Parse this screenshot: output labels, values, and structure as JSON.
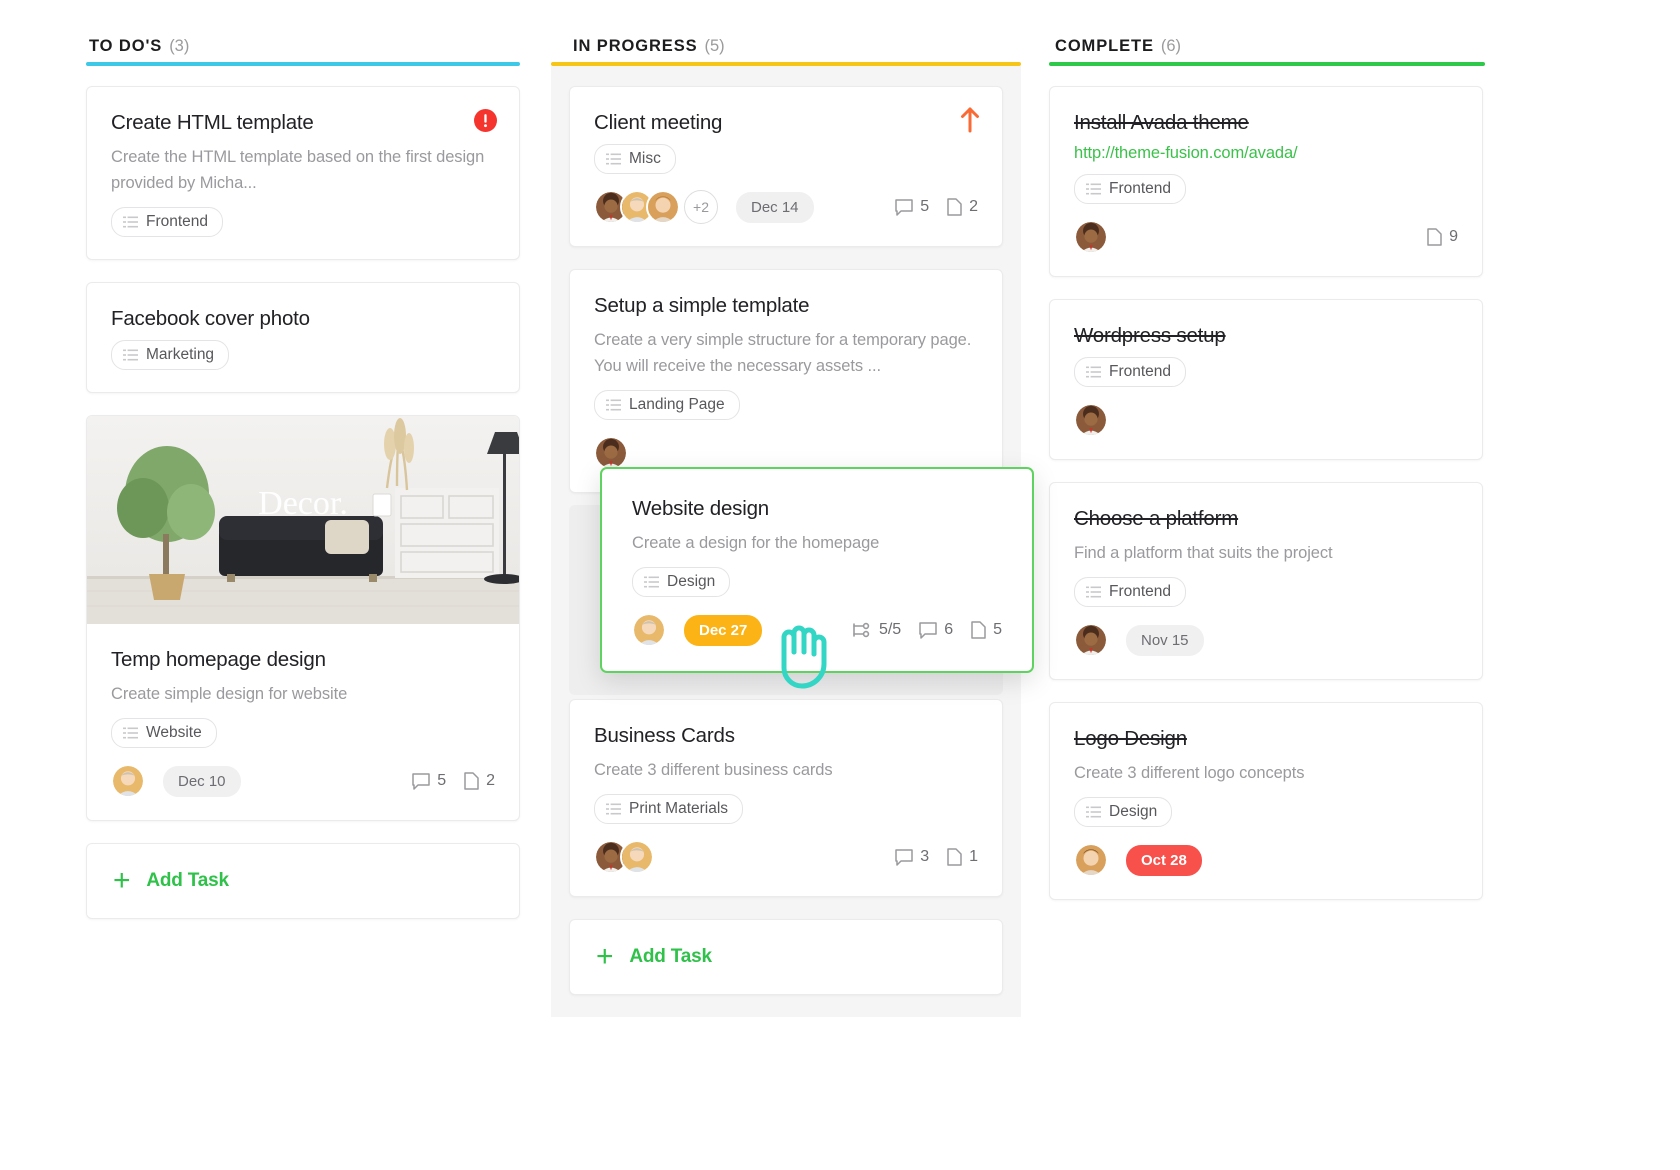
{
  "colors": {
    "todo_rule": "#3ec8e8",
    "progress_rule": "#f5c518",
    "complete_rule": "#2ec84a",
    "accent_green": "#2fc14a",
    "link_green": "#3bc14a",
    "amber_badge": "#fcb316",
    "red_badge": "#f8504b",
    "alert_red": "#f5342e",
    "arrow_orange": "#f96a34",
    "drag_border": "#5fd35f",
    "cursor_teal": "#33d6c4"
  },
  "columns": [
    {
      "id": "todo",
      "title": "TO DO'S",
      "count": "(3)",
      "add_task_label": "Add Task",
      "cards": [
        {
          "title": "Create HTML template",
          "desc": "Create the HTML template based on the first design provided by Micha...",
          "tag": "Frontend",
          "alert": true
        },
        {
          "title": "Facebook cover photo",
          "tag": "Marketing"
        },
        {
          "photo_caption": "Decor.",
          "title": "Temp homepage design",
          "desc": "Create simple design for website",
          "tag": "Website",
          "date": "Dec 10",
          "comments": "5",
          "files": "2"
        }
      ]
    },
    {
      "id": "progress",
      "title": "IN PROGRESS",
      "count": "(5)",
      "add_task_label": "Add Task",
      "cards": [
        {
          "title": "Client meeting",
          "tag": "Misc",
          "avatars_extra": "+2",
          "date": "Dec 14",
          "comments": "5",
          "files": "2",
          "priority_up": true
        },
        {
          "title": "Setup a simple template",
          "desc": "Create a very simple structure for a temporary page. You will receive the necessary assets ...",
          "tag": "Landing Page"
        },
        {
          "title": "Business Cards",
          "desc": "Create 3 different business cards",
          "tag": "Print Materials",
          "comments": "3",
          "files": "1"
        }
      ]
    },
    {
      "id": "complete",
      "title": "COMPLETE",
      "count": "(6)",
      "cards": [
        {
          "title": "Install Avada theme",
          "completed": true,
          "link": "http://theme-fusion.com/avada/",
          "tag": "Frontend",
          "files": "9"
        },
        {
          "title": "Wordpress setup",
          "completed": true,
          "tag": "Frontend"
        },
        {
          "title": "Choose a platform",
          "completed": true,
          "desc": "Find a platform that suits the project",
          "tag": "Frontend",
          "date": "Nov 15"
        },
        {
          "title": "Logo Design",
          "completed": true,
          "desc": "Create 3 different logo concepts",
          "tag": "Design",
          "date": "Oct 28"
        }
      ]
    }
  ],
  "dragging_card": {
    "title": "Website design",
    "desc": "Create a design for the homepage",
    "tag": "Design",
    "date": "Dec 27",
    "checklist": "5/5",
    "comments": "6",
    "files": "5"
  }
}
